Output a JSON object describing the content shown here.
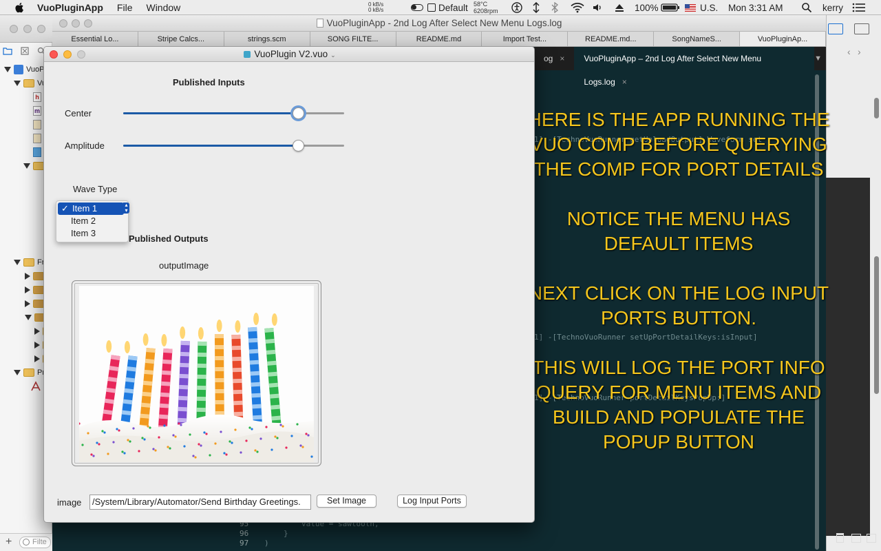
{
  "menubar": {
    "app_name": "VuoPluginApp",
    "menus": [
      "File",
      "Window"
    ],
    "net_up": "0 kB/s",
    "net_down": "0 kB/s",
    "display_profile": "Default",
    "temp": "58°C",
    "fan": "6208rpm",
    "battery": "100%",
    "input_source": "U.S.",
    "clock": "Mon 3:31 AM",
    "user": "kerry"
  },
  "log_window": {
    "title": "VuoPluginApp - 2nd Log After Select New Menu Logs.log",
    "tabs": [
      "Essential Lo...",
      "Stripe Calcs...",
      "strings.scm",
      "SONG FILTE...",
      "README.md",
      "Import Test...",
      "README.md...",
      "SongNameS...",
      "VuoPluginAp..."
    ],
    "editor_tab_partial": "og",
    "editor_tab_active": "VuoPluginApp – 2nd Log After Select New Menu Logs.log",
    "code_lines": [
      "1] -[TechnoVuoRunner getUnloadOutput] Waveform set",
      "1] -[TechnoVuoRunner setUpPortDetailKeys:isInput]",
      "1] -[TechnoVuoRunner portDetailKeysPopUp:]"
    ],
    "gutter": [
      "95",
      "96",
      "97"
    ],
    "bottom_code": "value = sawtooth,",
    "bottom_brace1": "}",
    "bottom_brace2": ")"
  },
  "annotation": [
    "HERE IS THE APP RUNNING THE VUO COMP BEFORE QUERYING THE COMP FOR PORT DETAILS",
    "NOTICE THE MENU HAS DEFAULT ITEMS",
    "NEXT CLICK ON THE LOG INPUT PORTS BUTTON.",
    "THIS WILL LOG THE PORT INFO QUERY FOR MENU ITEMS AND BUILD AND POPULATE THE POPUP BUTTON"
  ],
  "navigator": {
    "project": "VuoP",
    "group1": "Vu",
    "group2": "Fr",
    "group3": "Pr",
    "filter_placeholder": "Filte"
  },
  "plugin_window": {
    "title": "VuoPlugin V2.vuo",
    "published_inputs": "Published Inputs",
    "center_label": "Center",
    "center_value": 0.79,
    "amplitude_label": "Amplitude",
    "amplitude_value": 0.79,
    "wave_type_label": "Wave Type",
    "popup_items": [
      "Item 1",
      "Item 2",
      "Item 3"
    ],
    "popup_selected": "Item 1",
    "published_outputs": "Published Outputs",
    "output_image_label": "outputImage",
    "image_label": "image",
    "image_path": "/System/Library/Automator/Send Birthday Greetings.",
    "set_image_button": "Set Image",
    "log_input_ports_button": "Log Input Ports"
  },
  "colors": {
    "accent": "#1553b5",
    "overlay_text": "#f5c61d",
    "editor_bg": "#0f2a30"
  }
}
